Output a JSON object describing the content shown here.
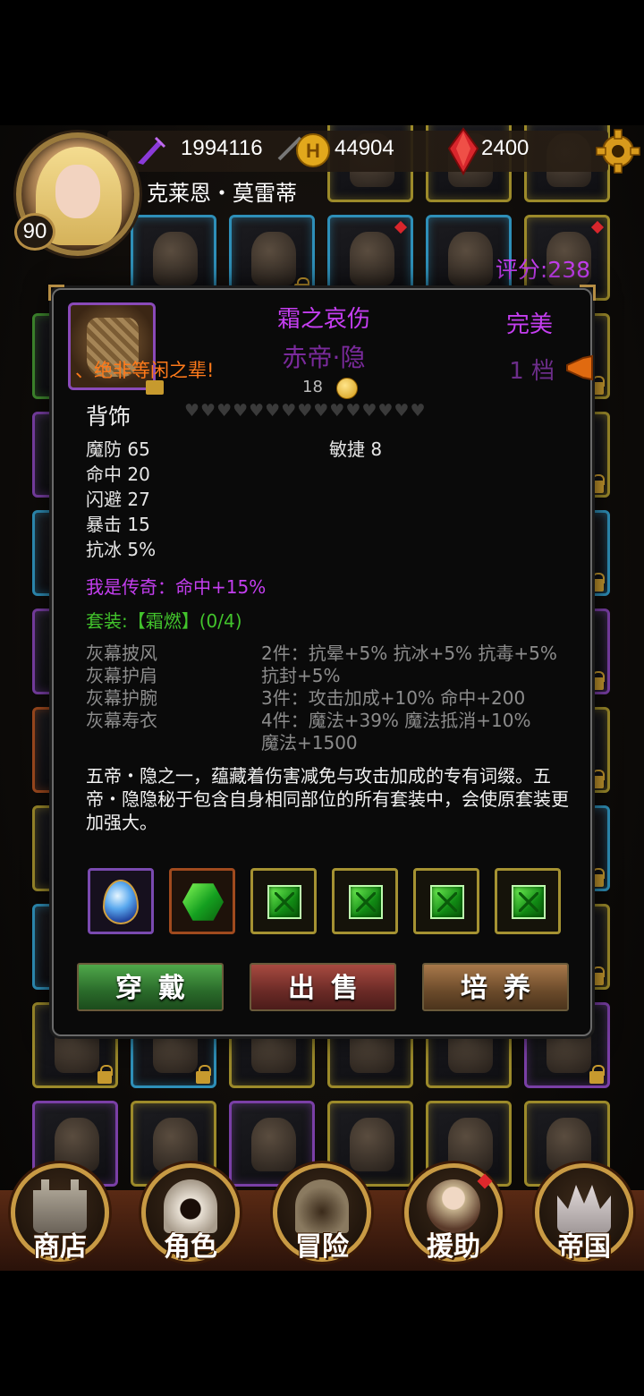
{
  "hud": {
    "souls": "1994116",
    "gold": "44904",
    "gems": "2400",
    "level": "90",
    "hero_name": "克莱恩・莫雷蒂",
    "score": "评分:238"
  },
  "item": {
    "name": "霜之哀伤",
    "subname": "赤帝·隐",
    "quality": "完美",
    "grade": "1 档",
    "broadcast": "、绝非等闲之辈!",
    "price": "18",
    "slot": "背饰",
    "hearts": "♥♥♥♥♥♥♥♥♥♥♥♥♥♥♥",
    "stats_left": [
      "魔防 65",
      "命中 20",
      "闪避 27",
      "暴击 15",
      "抗冰 5%"
    ],
    "stats_right": [
      "敏捷 8"
    ],
    "legend": "我是传奇：命中+15%",
    "set_title": "套装:【霜燃】(0/4)",
    "set_pieces": [
      "灰幕披风",
      "灰幕护肩",
      "灰幕护腕",
      "灰幕寿衣"
    ],
    "set_bonuses": [
      "2件：抗晕+5% 抗冰+5% 抗毒+5%",
      "抗封+5%",
      "3件：攻击加成+10% 命中+200",
      "4件：魔法+39% 魔法抵消+10%",
      "魔法+1500"
    ],
    "description": "五帝・隐之一，蕴藏着伤害减免与攻击加成的专有词缀。五帝・隐隐秘于包含自身相同部位的所有套装中，会使原套装更加强大。"
  },
  "actions": {
    "wear": "穿戴",
    "sell": "出售",
    "train": "培养"
  },
  "nav": {
    "shop": "商店",
    "character": "角色",
    "adventure": "冒险",
    "support": "援助",
    "empire": "帝国"
  },
  "colors": {
    "legendary_purple": "#c43ef0",
    "set_green": "#42c42c",
    "broadcast_orange": "#ff7a1a",
    "gold_trim": "#c89a44"
  }
}
